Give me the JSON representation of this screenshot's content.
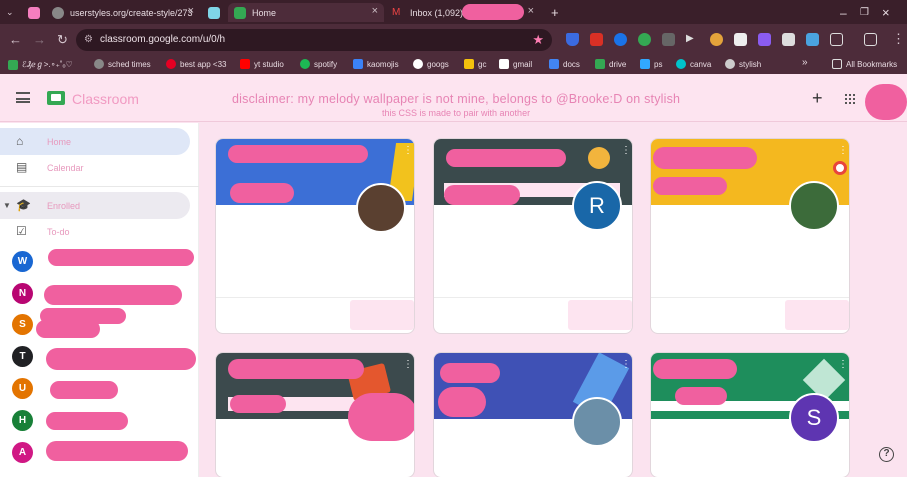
{
  "browser": {
    "tabs": [
      {
        "title": "userstyles.org/create-style/273",
        "color": "#f4a"
      },
      {
        "title": "",
        "color": "#7be"
      },
      {
        "title": "Home",
        "color": "#34a853"
      },
      {
        "title": "Inbox (1,092) -",
        "color": "#c33"
      }
    ],
    "new_tab_label": "+",
    "url": "classroom.google.com/u/0/h",
    "bookmarks": [
      {
        "label": "ℰ₰ℯℊ>.∘₊˚ₒ♡",
        "color": "#34a853"
      },
      {
        "label": "sched times",
        "color": "#888"
      },
      {
        "label": "best app <33",
        "color": "#e60023"
      },
      {
        "label": "yt studio",
        "color": "#ff0000"
      },
      {
        "label": "spotify",
        "color": "#1db954"
      },
      {
        "label": "kaomojis",
        "color": "#3b82f6"
      },
      {
        "label": "googs",
        "color": "#fff"
      },
      {
        "label": "gc",
        "color": "#f4c20d"
      },
      {
        "label": "gmail",
        "color": "#fff"
      },
      {
        "label": "docs",
        "color": "#4285f4"
      },
      {
        "label": "drive",
        "color": "#34a853"
      },
      {
        "label": "ps",
        "color": "#001e36"
      },
      {
        "label": "canva",
        "color": "#00c4cc"
      },
      {
        "label": "stylish",
        "color": "#ccc"
      }
    ],
    "more_label": "»",
    "all_bookmarks_label": "All Bookmarks"
  },
  "header": {
    "brand": "Classroom",
    "disclaimer": "disclaimer: my melody wallpaper is not mine, belongs to @Brooke:D on stylish",
    "subnote": "this CSS is made to pair with another",
    "add_label": "+"
  },
  "sidebar": {
    "home": "Home",
    "calendar": "Calendar",
    "enrolled": "Enrolled",
    "todo": "To-do",
    "classes": [
      {
        "initial": "W",
        "color": "#1967d2"
      },
      {
        "initial": "N",
        "color": "#b80672"
      },
      {
        "initial": "S",
        "color": "#e37400"
      },
      {
        "initial": "T",
        "color": "#202124"
      },
      {
        "initial": "U",
        "color": "#e37400"
      },
      {
        "initial": "H",
        "color": "#188038"
      },
      {
        "initial": "A",
        "color": "#d01884"
      }
    ]
  },
  "cards": [
    {
      "banner_color": "#3c6fd6",
      "avatar_initial": "",
      "avatar_color": "#5a4030"
    },
    {
      "banner_color": "#3a4a4c",
      "avatar_initial": "R",
      "avatar_color": "#1967a8"
    },
    {
      "banner_color": "#f4b81f",
      "avatar_initial": "",
      "avatar_color": "#3c6b3a"
    },
    {
      "banner_color": "#3c4a4d",
      "avatar_initial": "",
      "avatar_color": "#c0392b"
    },
    {
      "banner_color": "#3f51b5",
      "avatar_initial": "",
      "avatar_color": "#6b8fa8"
    },
    {
      "banner_color": "#1e8e5c",
      "avatar_initial": "S",
      "avatar_color": "#5e35b1"
    }
  ],
  "help_label": "?"
}
